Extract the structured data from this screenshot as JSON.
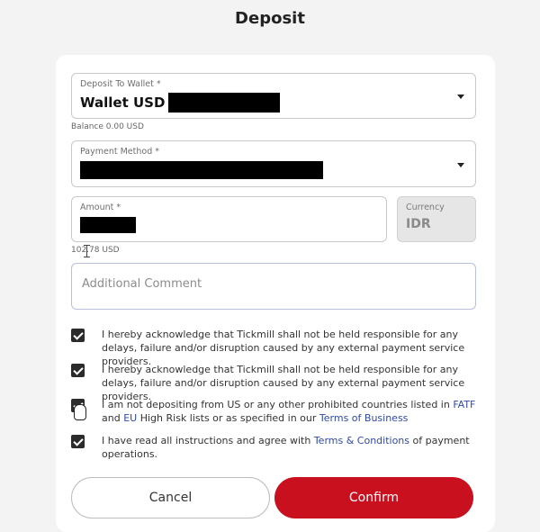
{
  "dialog": {
    "title": "Deposit"
  },
  "wallet": {
    "label": "Deposit To Wallet *",
    "value": "Wallet USD",
    "balance": "Balance 0.00 USD"
  },
  "payment_method": {
    "label": "Payment Method *"
  },
  "amount": {
    "label": "Amount *",
    "converted": "102.78 USD"
  },
  "currency": {
    "label": "Currency",
    "value": "IDR"
  },
  "comment": {
    "placeholder": "Additional Comment"
  },
  "acknowledgements": [
    {
      "text": "I hereby acknowledge that Tickmill shall not be held responsible for any delays, failure and/or disruption caused by any external payment service providers.",
      "checked": true
    },
    {
      "text": "I hereby acknowledge that Tickmill shall not be held responsible for any delays, failure and/or disruption caused by any external payment service providers.",
      "checked": true
    },
    {
      "text_1": "I am not depositing from US or any other prohibited countries listed in ",
      "link_fatf": "FATF",
      "text_2": " and ",
      "link_eu": "EU",
      "text_3": " High Risk lists or as specified in our ",
      "link_terms": "Terms of Business",
      "checked": true
    },
    {
      "text_1": "I have read all instructions and agree with ",
      "link_tc": "Terms & Conditions",
      "text_2": " of payment operations.",
      "checked": true
    }
  ],
  "buttons": {
    "cancel": "Cancel",
    "confirm": "Confirm"
  },
  "colors": {
    "confirm": "#c8101e",
    "link": "#2f4aa8",
    "checkbox": "#2b2b2b"
  }
}
